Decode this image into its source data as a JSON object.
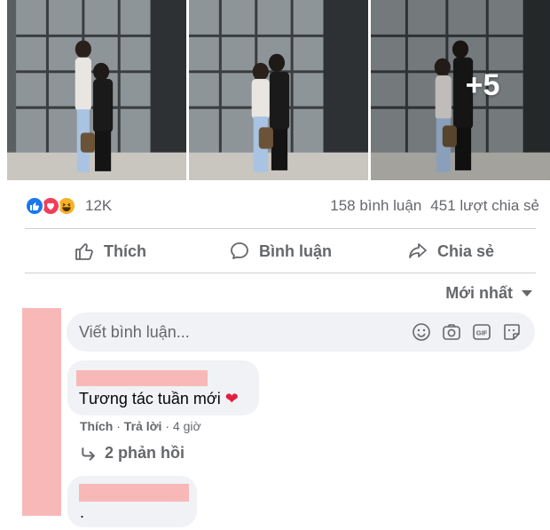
{
  "photos": {
    "more_count": "+5"
  },
  "reactions": {
    "icons": [
      "like-icon",
      "love-icon",
      "haha-icon"
    ],
    "count": "12K",
    "comments": "158 bình luận",
    "shares": "451 lượt chia sẻ",
    "colors": {
      "like": "#1877f2",
      "love": "#f33e58",
      "haha": "#f7b125"
    }
  },
  "actions": {
    "like": "Thích",
    "comment": "Bình luận",
    "share": "Chia sẻ"
  },
  "sort": {
    "label": "Mới nhất"
  },
  "comment_box": {
    "placeholder": "Viết bình luận...",
    "icons": [
      "emoji-icon",
      "camera-icon",
      "gif-icon",
      "sticker-icon"
    ]
  },
  "comments": [
    {
      "text": "Tương tác tuần mới",
      "emoji": "❤",
      "meta": {
        "like": "Thích",
        "reply": "Trả lời",
        "time": "4 giờ"
      },
      "replies": "2 phản hồi"
    },
    {
      "text": "."
    }
  ]
}
